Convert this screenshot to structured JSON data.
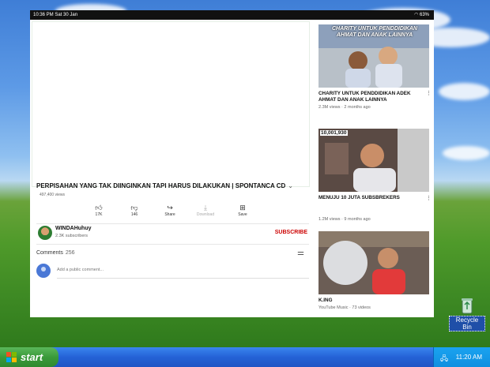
{
  "statusbar": {
    "time": "10:36 PM  Sat 30 Jan",
    "battery": "63%"
  },
  "video": {
    "title": "PERPISAHAN YANG TAK DIINGINKAN TAPI HARUS DILAKUKAN  |  SPONTANCA CD",
    "views": "497,400 views",
    "actions": [
      {
        "icon": "thumbs-up-icon",
        "label": "17K"
      },
      {
        "icon": "thumbs-down-icon",
        "label": "146"
      },
      {
        "icon": "share-icon",
        "label": "Share"
      },
      {
        "icon": "download-icon",
        "label": "Download"
      },
      {
        "icon": "save-icon",
        "label": "Save"
      }
    ]
  },
  "channel": {
    "name": "WINDAHuhuy",
    "subscribers": "2.3K subscribers",
    "subscribe_label": "SUBSCRIBE"
  },
  "comments": {
    "heading": "Comments",
    "count": "256",
    "placeholder": "Add a public comment..."
  },
  "related": [
    {
      "title": "CHARITY UNTUK PENDDIDIKAN ADEK AHMAT DAN ANAK LAINNYA",
      "meta": "2.3M views · 2 months ago",
      "thumb_text": "CHARITY UNTUK PENDDIDIKAN AHMAT DAN ANAK LAINNYA"
    },
    {
      "title": "MENUJU 10 JUTA SUBSBREKERS",
      "meta": "1.2M views · 9 months ago",
      "thumb_text": "10,001,930"
    },
    {
      "title": "K.ING",
      "meta": "YouTube Music · 73 videos"
    }
  ],
  "desktop": {
    "recycle_bin_label": "Recycle Bin"
  },
  "taskbar": {
    "start_label": "start",
    "clock": "11:20 AM"
  },
  "colors": {
    "subscribe": "#cc0000",
    "taskbar": "#2462d6",
    "start": "#3a9a3a"
  }
}
